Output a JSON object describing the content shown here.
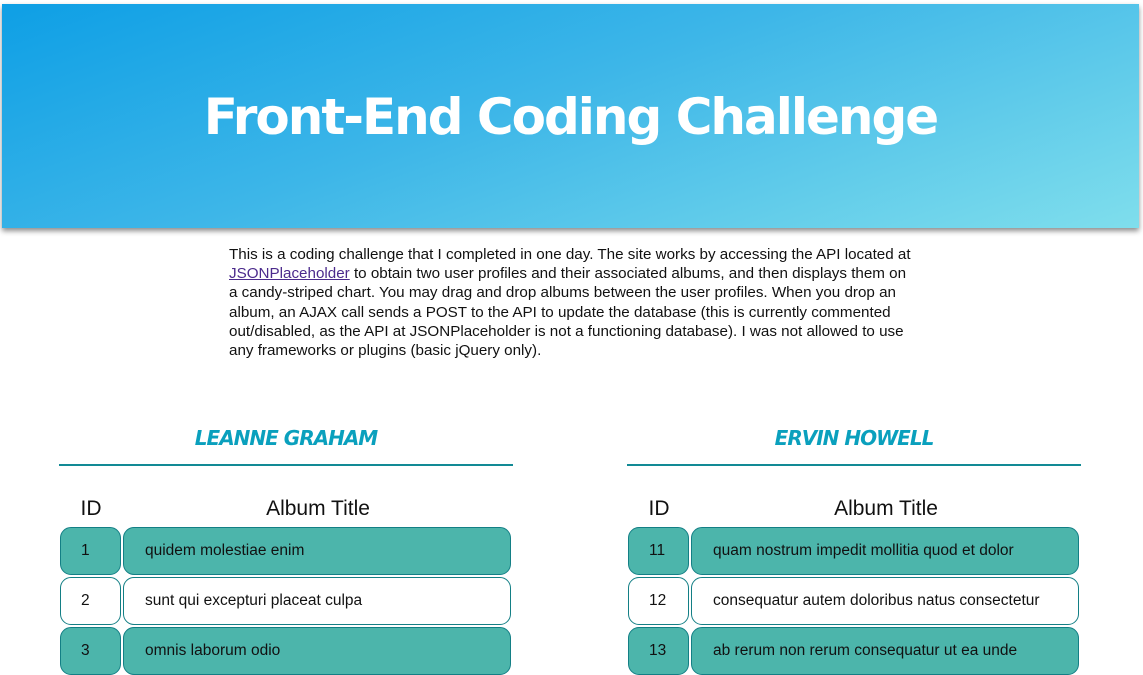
{
  "header": {
    "title": "Front-End Coding Challenge"
  },
  "intro": {
    "text_before_link": "This is a coding challenge that I completed in one day. The site works by accessing the API located at ",
    "link_text": "JSONPlaceholder",
    "text_after_link": " to obtain two user profiles and their associated albums, and then displays them on a candy-striped chart. You may drag and drop albums between the user profiles. When you drop an album, an AJAX call sends a POST to the API to update the database (this is currently commented out/disabled, as the API at JSONPlaceholder is not a functioning database). I was not allowed to use any frameworks or plugins (basic jQuery only)."
  },
  "users": [
    {
      "name": "Leanne Graham",
      "columns": {
        "id": "ID",
        "title": "Album Title"
      },
      "albums": [
        {
          "id": "1",
          "title": "quidem molestiae enim"
        },
        {
          "id": "2",
          "title": "sunt qui excepturi placeat culpa"
        },
        {
          "id": "3",
          "title": "omnis laborum odio"
        }
      ]
    },
    {
      "name": "Ervin Howell",
      "columns": {
        "id": "ID",
        "title": "Album Title"
      },
      "albums": [
        {
          "id": "11",
          "title": "quam nostrum impedit mollitia quod et dolor"
        },
        {
          "id": "12",
          "title": "consequatur autem doloribus natus consectetur"
        },
        {
          "id": "13",
          "title": "ab rerum non rerum consequatur ut ea unde"
        }
      ]
    }
  ],
  "colors": {
    "header_gradient_start": "#0e9fe5",
    "header_gradient_end": "#7fdeec",
    "row_teal": "#4cb5ab",
    "row_border": "#137f85",
    "user_name": "#0aa0bd",
    "link": "#4b2a8c"
  }
}
